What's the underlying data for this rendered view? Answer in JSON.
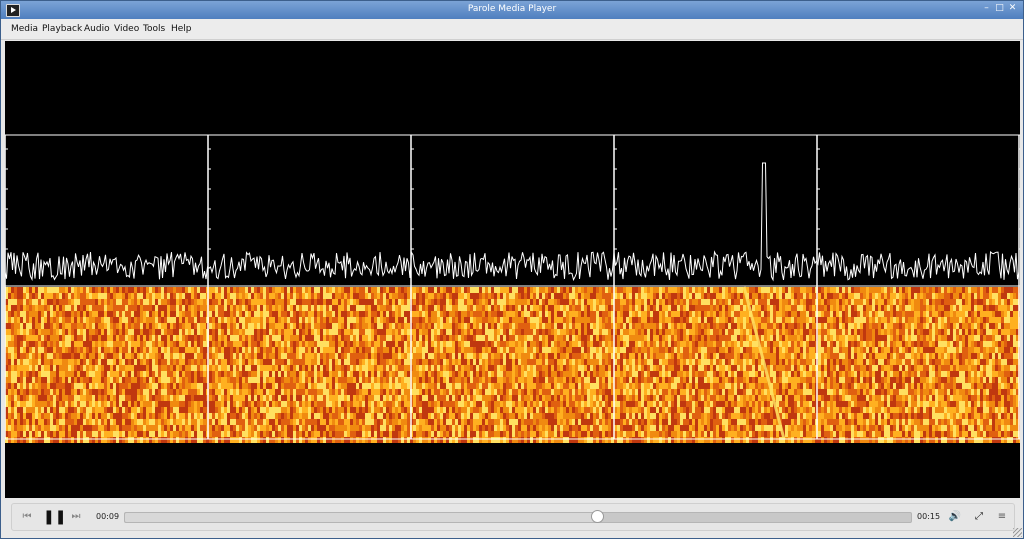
{
  "window": {
    "title": "Parole Media Player",
    "min_glyph": "–",
    "max_glyph": "□",
    "close_glyph": "✕"
  },
  "menubar": {
    "items": [
      "Media",
      "Playback",
      "Audio",
      "Video",
      "Tools",
      "Help"
    ]
  },
  "controls": {
    "prev_icon": "⏮",
    "pause_icon": "❚❚",
    "next_icon": "⏭",
    "elapsed": "00:09",
    "duration": "00:15",
    "position_fraction": 0.6,
    "volume_icon": "🔊",
    "fullscreen_icon": "⤢",
    "menu_icon": "≡"
  },
  "video": {
    "colors": {
      "background": "#000000",
      "waveform": "#ffffff",
      "spectrogram_low": "#c0380f",
      "spectrogram_mid": "#f08a10",
      "spectrogram_high": "#ffe060"
    },
    "panels": 5,
    "signal_panel_index": 3
  }
}
